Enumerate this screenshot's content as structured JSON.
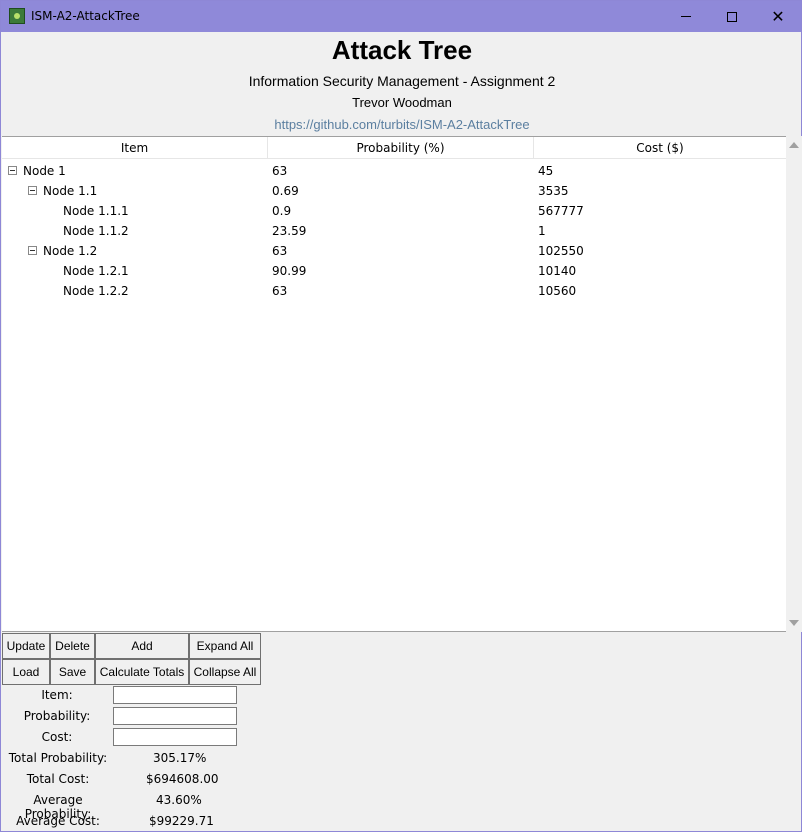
{
  "window": {
    "title": "ISM-A2-AttackTree",
    "app_icon": "leaf-app-icon",
    "controls": {
      "minimize": "minimize-icon",
      "maximize": "maximize-icon",
      "close": "close-icon",
      "close_glyph": "✕"
    }
  },
  "header": {
    "title": "Attack Tree",
    "subtitle": "Information Security Management - Assignment 2",
    "author": "Trevor Woodman",
    "link": "https://github.com/turbits/ISM-A2-AttackTree"
  },
  "tree": {
    "columns": [
      "Item",
      "Probability (%)",
      "Cost ($)"
    ],
    "rows": [
      {
        "item": "Node 1",
        "probability": "63",
        "cost": "45",
        "depth": 0,
        "expandable": true
      },
      {
        "item": "Node 1.1",
        "probability": "0.69",
        "cost": "3535",
        "depth": 1,
        "expandable": true
      },
      {
        "item": "Node 1.1.1",
        "probability": "0.9",
        "cost": "567777",
        "depth": 2,
        "expandable": false
      },
      {
        "item": "Node 1.1.2",
        "probability": "23.59",
        "cost": "1",
        "depth": 2,
        "expandable": false
      },
      {
        "item": "Node 1.2",
        "probability": "63",
        "cost": "102550",
        "depth": 1,
        "expandable": true
      },
      {
        "item": "Node 1.2.1",
        "probability": "90.99",
        "cost": "10140",
        "depth": 2,
        "expandable": false
      },
      {
        "item": "Node 1.2.2",
        "probability": "63",
        "cost": "10560",
        "depth": 2,
        "expandable": false
      }
    ]
  },
  "buttons": {
    "update": "Update",
    "delete": "Delete",
    "add": "Add",
    "expand_all": "Expand All",
    "load": "Load",
    "save": "Save",
    "calculate_totals": "Calculate Totals",
    "collapse_all": "Collapse All"
  },
  "form": {
    "item_label": "Item:",
    "item_value": "",
    "probability_label": "Probability:",
    "probability_value": "",
    "cost_label": "Cost:",
    "cost_value": ""
  },
  "stats": {
    "total_probability_label": "Total Probability:",
    "total_probability": "305.17%",
    "total_cost_label": "Total Cost:",
    "total_cost": "$694608.00",
    "average_probability_label": "Average Probability:",
    "average_probability": "43.60%",
    "average_cost_label": "Average Cost:",
    "average_cost": "$99229.71"
  },
  "colors": {
    "titlebar": "#8f89d9",
    "link": "#5b7fa0",
    "background": "#f0f0f0"
  }
}
